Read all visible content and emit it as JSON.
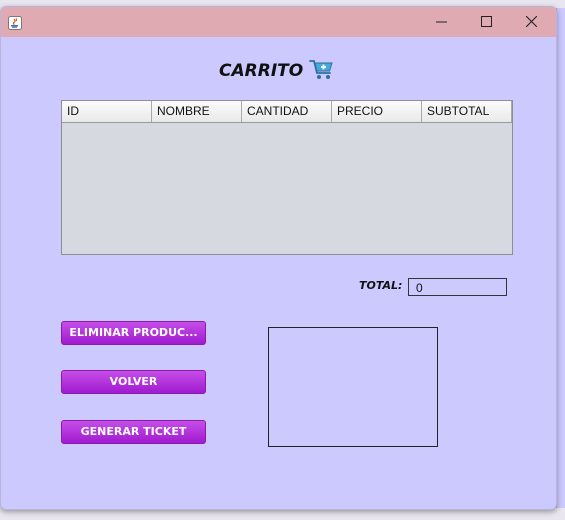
{
  "window": {
    "title": ""
  },
  "heading": "CARRITO",
  "table": {
    "columns": [
      "ID",
      "NOMBRE",
      "CANTIDAD",
      "PRECIO",
      "SUBTOTAL"
    ],
    "rows": []
  },
  "total": {
    "label": "TOTAL:",
    "value": "0"
  },
  "buttons": {
    "eliminar": "ELIMINAR PRODUC...",
    "volver": "VOLVER",
    "ticket": "GENERAR TICKET"
  },
  "colors": {
    "background": "#ccc9ff",
    "titlebar": "#e0aab2",
    "button": "#b22fdc",
    "table_body": "#d6d9df"
  },
  "icons": {
    "app": "java-icon",
    "cart": "shopping-cart-icon",
    "minimize": "minimize-icon",
    "maximize": "maximize-icon",
    "close": "close-icon"
  }
}
